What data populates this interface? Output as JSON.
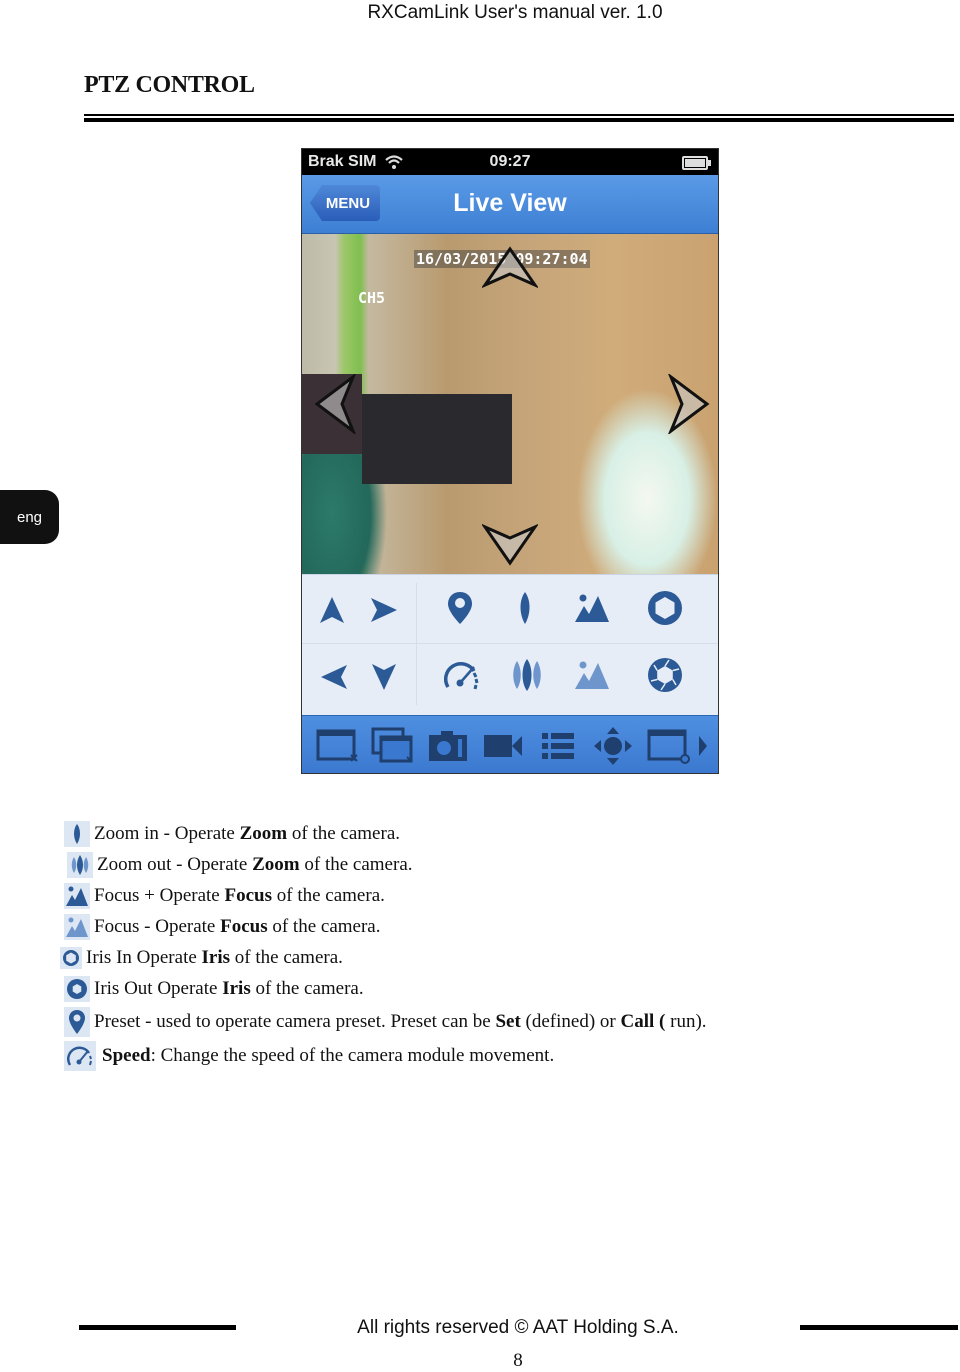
{
  "header": {
    "doc_title": "RXCamLink User's manual ver. 1.0"
  },
  "section": {
    "title": "PTZ CONTROL"
  },
  "side_tab": {
    "label": "eng"
  },
  "phone": {
    "status_bar": {
      "carrier": "Brak SIM",
      "time": "09:27",
      "wifi_icon": "wifi-icon",
      "battery_icon": "battery-icon"
    },
    "nav_bar": {
      "back_label": "MENU",
      "title": "Live View"
    },
    "video": {
      "timestamp": "16/03/2015 09:27:04",
      "channel": "CH5"
    },
    "ptz_buttons": [
      {
        "name": "tilt-up",
        "icon": "arrow-up-icon"
      },
      {
        "name": "pan-right",
        "icon": "arrow-right-icon"
      },
      {
        "name": "preset",
        "icon": "map-pin-icon"
      },
      {
        "name": "zoom-in",
        "icon": "zoom-in-icon"
      },
      {
        "name": "focus-plus",
        "icon": "focus-plus-icon"
      },
      {
        "name": "iris-in",
        "icon": "iris-in-icon"
      },
      {
        "name": "pan-left",
        "icon": "arrow-left-icon"
      },
      {
        "name": "tilt-down",
        "icon": "arrow-down-icon"
      },
      {
        "name": "speed",
        "icon": "speedometer-icon"
      },
      {
        "name": "zoom-out",
        "icon": "zoom-out-icon"
      },
      {
        "name": "focus-minus",
        "icon": "focus-minus-icon"
      },
      {
        "name": "iris-out",
        "icon": "iris-out-icon"
      }
    ],
    "toolbar": [
      "close-window-icon",
      "close-all-windows-icon",
      "camera-snapshot-icon",
      "video-record-icon",
      "list-icon",
      "ptz-joystick-icon",
      "window-playback-icon",
      "more-arrow-icon"
    ],
    "accent_color": "#3d7fd3",
    "icon_color": "#2b5a96"
  },
  "legend": [
    {
      "icon": "zoom-in-icon",
      "pre": "Zoom in - Operate ",
      "bold": "Zoom",
      "post": " of the camera."
    },
    {
      "icon": "zoom-out-icon",
      "pre": "Zoom out - Operate ",
      "bold": "Zoom",
      "post": " of the camera."
    },
    {
      "icon": "focus-plus-icon",
      "pre": "Focus + Operate ",
      "bold": "Focus",
      "post": " of the camera."
    },
    {
      "icon": "focus-minus-icon",
      "pre": "Focus - Operate ",
      "bold": "Focus",
      "post": " of the camera."
    },
    {
      "icon": "iris-in-icon",
      "pre": "Iris In Operate ",
      "bold": "Iris",
      "post": " of the camera."
    },
    {
      "icon": "iris-out-icon",
      "pre": "Iris Out Operate ",
      "bold": "Iris",
      "post": " of the camera."
    },
    {
      "icon": "map-pin-icon",
      "pre": "Preset - used to operate camera preset. Preset can be ",
      "bold": "Set",
      "mid": " (defined) or ",
      "bold2": "Call (",
      "post": " run)."
    },
    {
      "icon": "speedometer-icon",
      "pre": "",
      "bold": "Speed",
      "post": ": Change the speed of the camera module movement."
    }
  ],
  "footer": {
    "copyright": "All rights reserved © AAT Holding S.A.",
    "page_number": "8"
  }
}
